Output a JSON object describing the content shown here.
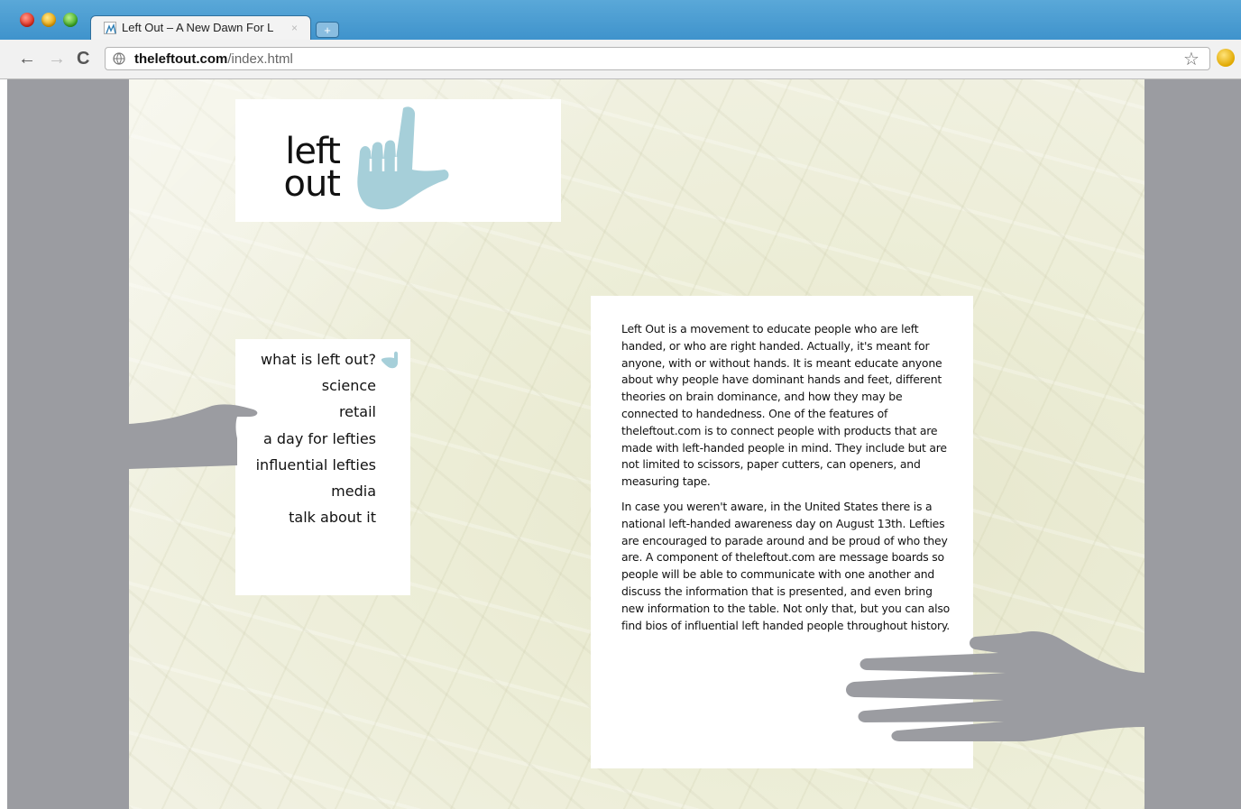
{
  "browser": {
    "tab_title": "Left Out – A New Dawn For L",
    "tab_close": "×",
    "new_tab": "+",
    "url_domain": "theleftout.com",
    "url_path": "/index.html",
    "back": "←",
    "forward": "→",
    "reload": "C",
    "bookmark_star": "☆"
  },
  "logo": {
    "line1": "left",
    "line2": "out",
    "hand_color": "#a6cfd9"
  },
  "nav": {
    "items": [
      "what is left out?",
      "science",
      "retail",
      "a day for lefties",
      "influential lefties",
      "media",
      "talk about it"
    ]
  },
  "content": {
    "paragraph1": "Left Out is a movement to educate people who are left handed, or who are right handed. Actually, it's meant for anyone, with or without hands. It is meant educate anyone about why people have dominant hands and feet, different theories on brain dominance, and how they may be connected to handedness. One of the features of theleftout.com is to connect people with products that are made with left-handed people in mind. They include but are not limited to scissors, paper cutters, can openers, and measuring tape.",
    "paragraph2": "In case you weren't aware, in the United States there is a national left-handed awareness day on August 13th. Lefties are encouraged to parade around and be proud of who they are. A component of theleftout.com are message boards so people will be able to communicate with one another and discuss the information that is presented, and even bring new information to the table. Not only that, but you can also find bios of influential left handed people throughout history."
  },
  "colors": {
    "hand_gray": "#9b9ca1",
    "accent_blue": "#a6cfd9"
  }
}
